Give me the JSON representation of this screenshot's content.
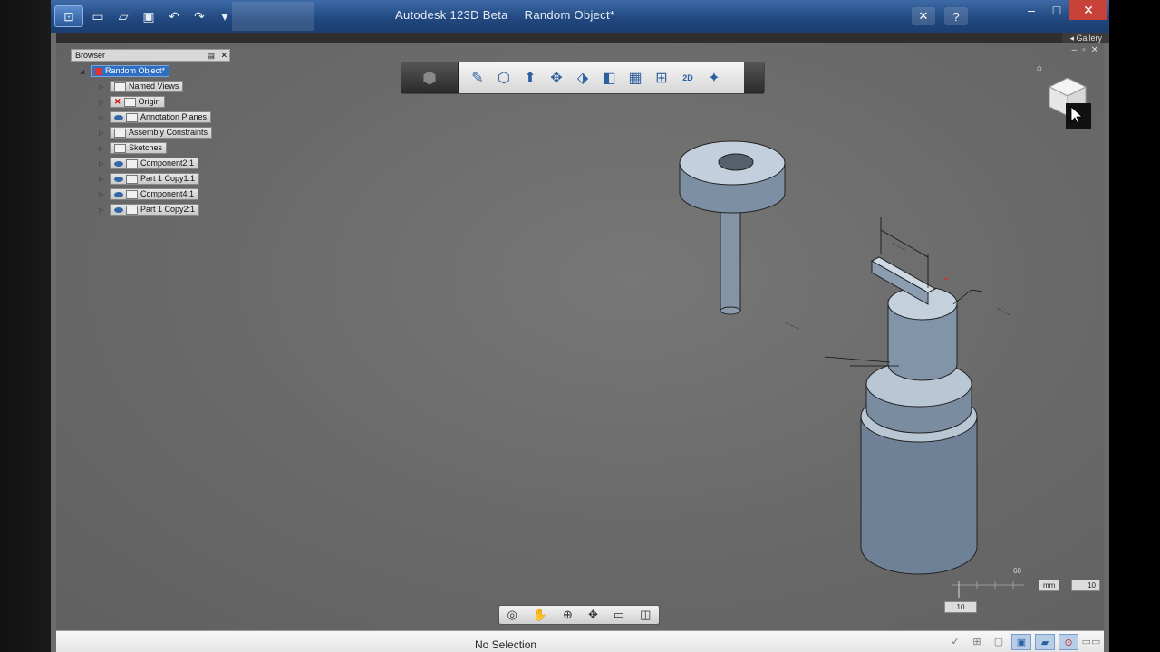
{
  "window": {
    "app_title": "Autodesk 123D Beta",
    "doc_title": "Random Object*"
  },
  "gallery": {
    "label": "Gallery"
  },
  "browser": {
    "title": "Browser",
    "root": "Random Object*",
    "items": [
      {
        "label": "Named Views"
      },
      {
        "label": "Origin"
      },
      {
        "label": "Annotation Planes"
      },
      {
        "label": "Assembly Constraints"
      },
      {
        "label": "Sketches"
      },
      {
        "label": "Component2:1"
      },
      {
        "label": "Part 1 Copy1:1"
      },
      {
        "label": "Component4:1"
      },
      {
        "label": "Part 1 Copy2:1"
      }
    ]
  },
  "status": {
    "text": "No Selection"
  },
  "ruler": {
    "scale_value": "60",
    "unit": "mm",
    "grid_value": "10",
    "tick_value": "10"
  },
  "colors": {
    "titlebar": "#20477e",
    "canvas": "#6c6c6c",
    "selection": "#2f6fc2"
  }
}
